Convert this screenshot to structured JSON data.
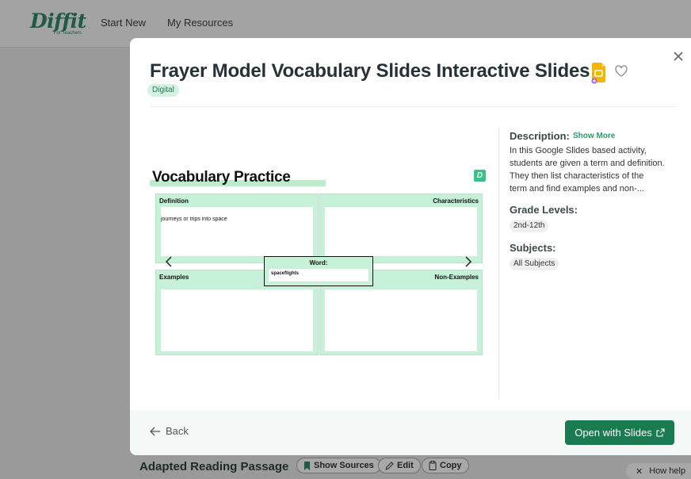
{
  "app": {
    "logo": {
      "word": "Diffit",
      "sub": "For Teachers"
    },
    "nav": [
      {
        "label": "Start New"
      },
      {
        "label": "My Resources"
      }
    ]
  },
  "background": {
    "title": "Adapted Reading Passage",
    "buttons": {
      "show_sources": "Show Sources",
      "edit": "Edit",
      "copy": "Copy"
    },
    "help": "How help"
  },
  "modal": {
    "title": "Frayer Model Vocabulary Slides Interactive Slides",
    "tag": "Digital",
    "slide": {
      "title": "Vocabulary Practice",
      "badge": "D",
      "quadrants": {
        "definition": {
          "label": "Definition",
          "content": "journeys or trips into space"
        },
        "characteristics": {
          "label": "Characteristics",
          "content": ""
        },
        "examples": {
          "label": "Examples",
          "content": ""
        },
        "non_examples": {
          "label": "Non-Examples",
          "content": ""
        }
      },
      "word": {
        "label": "Word:",
        "value": "spaceflights"
      }
    },
    "description": {
      "label": "Description:",
      "show_more": "Show More",
      "lines": [
        "In this Google Slides based activity,",
        "students are given a term and definition.",
        "They then list characteristics of the",
        "term and find examples and non-..."
      ]
    },
    "grade_levels": {
      "label": "Grade Levels:",
      "chips": [
        "2nd-12th"
      ]
    },
    "subjects": {
      "label": "Subjects:",
      "chips": [
        "All Subjects"
      ]
    },
    "footer": {
      "back": "Back",
      "open": "Open with Slides"
    }
  },
  "colors": {
    "accent": "#1a7a50",
    "mint": "#c7f0d8",
    "link": "#2c9a66"
  }
}
